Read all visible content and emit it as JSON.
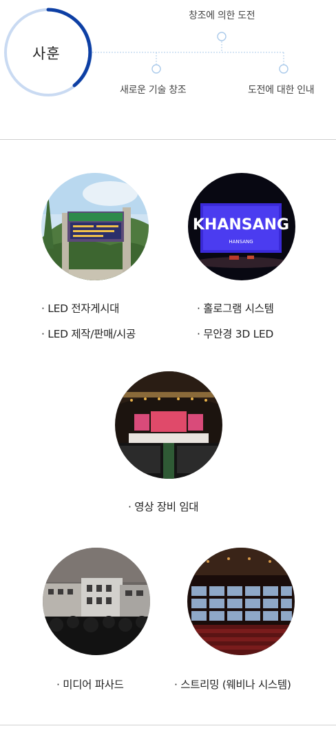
{
  "motto": {
    "center_label": "사훈",
    "top_label": "창조에 의한 도전",
    "left_label": "새로운 기술 창조",
    "right_label": "도전에 대한 인내",
    "accent_color": "#0d3fa4",
    "ring_color": "#c9daf2",
    "line_color": "#a9c9ea"
  },
  "services": {
    "led_sign": {
      "item_1": "· LED 전자게시대",
      "item_2": "· LED 제작/판매/시공"
    },
    "hologram": {
      "item_1": "· 홀로그램 시스템",
      "item_2": "· 무안경 3D LED"
    },
    "rental": {
      "item_1": "· 영상 장비 임대"
    },
    "facade": {
      "item_1": "· 미디어 파사드"
    },
    "streaming": {
      "item_1": "· 스트리밍 (웨비나 시스템)"
    },
    "hologram_screen_text": {
      "logo": "KHANSANG",
      "subtitle": "HANSANG"
    }
  }
}
